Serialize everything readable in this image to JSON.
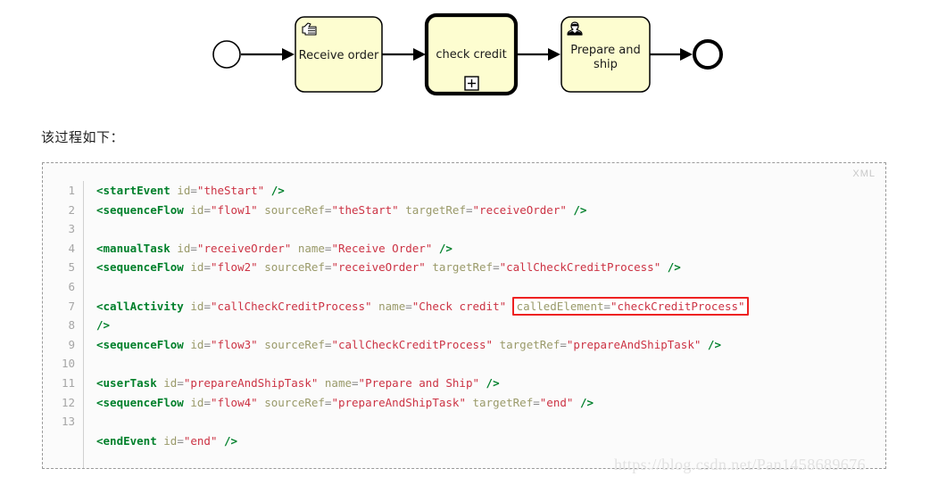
{
  "diagram": {
    "title": "bpmn-call-activity-process",
    "colors": {
      "task_fill": "#fdfdd0",
      "task_stroke": "#000000",
      "connector": "#000000",
      "marker": "#000000"
    },
    "nodes": [
      {
        "id": "start",
        "type": "start-event",
        "label": ""
      },
      {
        "id": "receiveOrder",
        "type": "manual-task",
        "label": "Receive order",
        "icon": "hand-icon"
      },
      {
        "id": "checkCredit",
        "type": "call-activity",
        "label": "check credit",
        "icon": "plus-marker-icon"
      },
      {
        "id": "prepareAndShip",
        "type": "user-task",
        "label_line1": "Prepare and",
        "label_line2": "ship",
        "icon": "user-icon"
      },
      {
        "id": "end",
        "type": "end-event",
        "label": ""
      }
    ]
  },
  "intro": {
    "text": "该过程如下："
  },
  "code": {
    "language_label": "XML",
    "line_numbers": [
      "1",
      "2",
      "3",
      "4",
      "5",
      "6",
      "7",
      "8",
      "9",
      "10",
      "11",
      "12",
      "13"
    ],
    "lines": [
      "<startEvent id=\"theStart\" />",
      "<sequenceFlow id=\"flow1\" sourceRef=\"theStart\" targetRef=\"receiveOrder\" />",
      "",
      "<manualTask id=\"receiveOrder\" name=\"Receive Order\" />",
      "<sequenceFlow id=\"flow2\" sourceRef=\"receiveOrder\" targetRef=\"callCheckCreditProcess\" />",
      "",
      "<callActivity id=\"callCheckCreditProcess\" name=\"Check credit\" calledElement=\"checkCreditProcess\"",
      "/>",
      "<sequenceFlow id=\"flow3\" sourceRef=\"callCheckCreditProcess\" targetRef=\"prepareAndShipTask\" />",
      "",
      "<userTask id=\"prepareAndShipTask\" name=\"Prepare and Ship\" />",
      "<sequenceFlow id=\"flow4\" sourceRef=\"prepareAndShipTask\" targetRef=\"end\" />",
      "",
      "<endEvent id=\"end\" />"
    ],
    "highlight": {
      "text": "calledElement=\"checkCreditProcess\"",
      "color": "#ee2222",
      "on_line": 7
    },
    "tokens": {
      "l1": {
        "tag_open": "<startEvent",
        "a1": "id",
        "v1": "\"theStart\"",
        "close": "/>"
      },
      "l2": {
        "tag_open": "<sequenceFlow",
        "a1": "id",
        "v1": "\"flow1\"",
        "a2": "sourceRef",
        "v2": "\"theStart\"",
        "a3": "targetRef",
        "v3": "\"receiveOrder\"",
        "close": "/>"
      },
      "l4": {
        "tag_open": "<manualTask",
        "a1": "id",
        "v1": "\"receiveOrder\"",
        "a2": "name",
        "v2": "\"Receive Order\"",
        "close": "/>"
      },
      "l5": {
        "tag_open": "<sequenceFlow",
        "a1": "id",
        "v1": "\"flow2\"",
        "a2": "sourceRef",
        "v2": "\"receiveOrder\"",
        "a3": "targetRef",
        "v3": "\"callCheckCreditProcess\"",
        "close": "/>"
      },
      "l7": {
        "tag_open": "<callActivity",
        "a1": "id",
        "v1": "\"callCheckCreditProcess\"",
        "a2": "name",
        "v2": "\"Check credit\"",
        "a3": "calledElement",
        "v3": "\"checkCreditProcess\""
      },
      "l8": {
        "close": "/>"
      },
      "l9": {
        "tag_open": "<sequenceFlow",
        "a1": "id",
        "v1": "\"flow3\"",
        "a2": "sourceRef",
        "v2": "\"callCheckCreditProcess\"",
        "a3": "targetRef",
        "v3": "\"prepareAndShipTask\"",
        "close": "/>"
      },
      "l11": {
        "tag_open": "<userTask",
        "a1": "id",
        "v1": "\"prepareAndShipTask\"",
        "a2": "name",
        "v2": "\"Prepare and Ship\"",
        "close": "/>"
      },
      "l12": {
        "tag_open": "<sequenceFlow",
        "a1": "id",
        "v1": "\"flow4\"",
        "a2": "sourceRef",
        "v2": "\"prepareAndShipTask\"",
        "a3": "targetRef",
        "v3": "\"end\"",
        "close": "/>"
      },
      "l14": {
        "tag_open": "<endEvent",
        "a1": "id",
        "v1": "\"end\"",
        "close": "/>"
      }
    }
  },
  "watermark": {
    "text": "https://blog.csdn.net/Pan1458689676"
  }
}
